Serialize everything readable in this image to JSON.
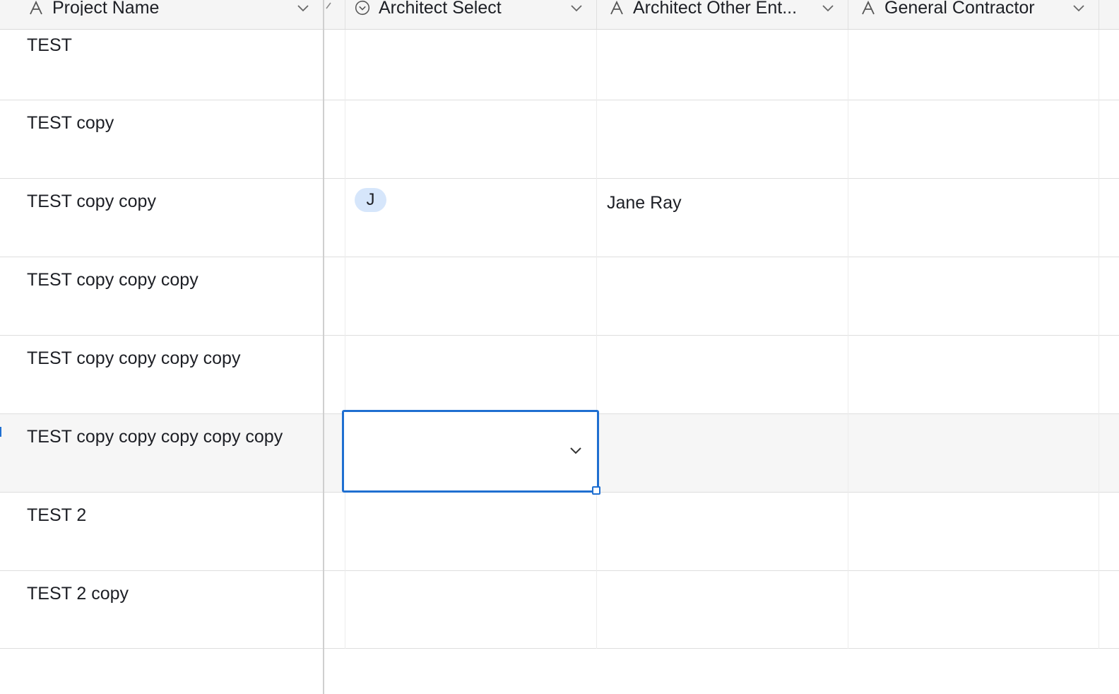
{
  "columns": [
    {
      "label": "Project Name",
      "icon": "text-field-icon"
    },
    {
      "label": "Architect Select",
      "icon": "single-select-icon"
    },
    {
      "label": "Architect Other Ent...",
      "icon": "text-field-icon"
    },
    {
      "label": "General Contractor",
      "icon": "text-field-icon"
    }
  ],
  "rows": [
    {
      "project_name": "TEST",
      "architect_select": "",
      "architect_other": "",
      "general_contractor": ""
    },
    {
      "project_name": "TEST copy",
      "architect_select": "",
      "architect_other": "",
      "general_contractor": ""
    },
    {
      "project_name": "TEST copy copy",
      "architect_select": "J",
      "architect_other": "Jane Ray",
      "general_contractor": ""
    },
    {
      "project_name": "TEST copy copy copy",
      "architect_select": "",
      "architect_other": "",
      "general_contractor": ""
    },
    {
      "project_name": "TEST copy copy copy copy",
      "architect_select": "",
      "architect_other": "",
      "general_contractor": ""
    },
    {
      "project_name": "TEST copy copy copy copy copy",
      "architect_select": "",
      "architect_other": "",
      "general_contractor": ""
    },
    {
      "project_name": "TEST 2",
      "architect_select": "",
      "architect_other": "",
      "general_contractor": ""
    },
    {
      "project_name": "TEST 2 copy",
      "architect_select": "",
      "architect_other": "",
      "general_contractor": ""
    }
  ],
  "colors": {
    "accent": "#1f6fd1",
    "pill": "#d6e6fb",
    "selected_row": "#f6f6f6"
  }
}
